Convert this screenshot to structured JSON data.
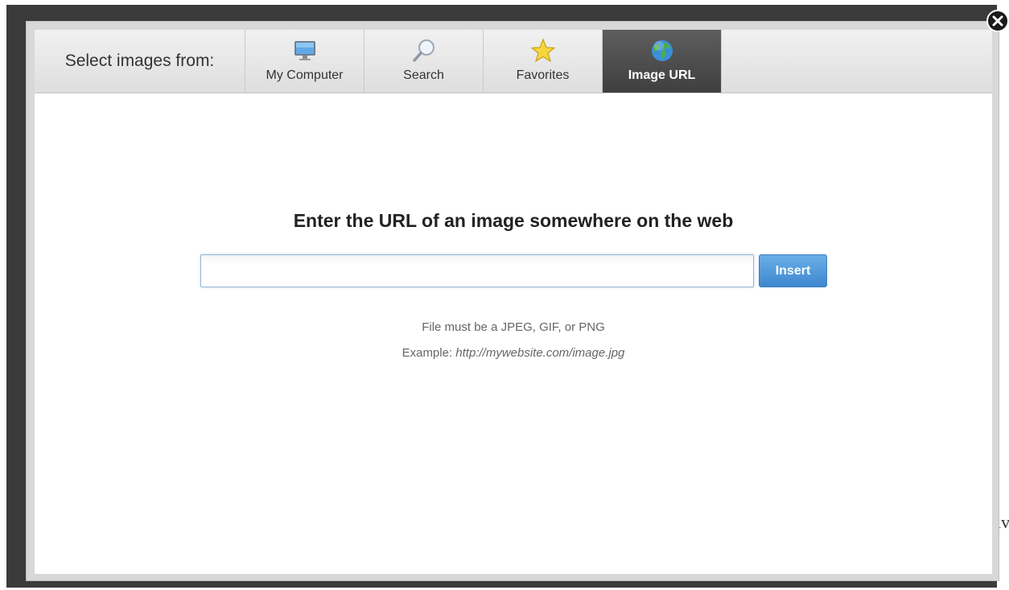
{
  "tabbar": {
    "label": "Select images from:",
    "tabs": [
      {
        "label": "My Computer",
        "icon": "monitor-icon",
        "active": false
      },
      {
        "label": "Search",
        "icon": "magnifier-icon",
        "active": false
      },
      {
        "label": "Favorites",
        "icon": "star-icon",
        "active": false
      },
      {
        "label": "Image URL",
        "icon": "globe-icon",
        "active": true
      }
    ]
  },
  "main": {
    "heading": "Enter the URL of an image somewhere on the web",
    "url_input": {
      "value": "",
      "placeholder": ""
    },
    "insert_label": "Insert",
    "hint_formats": "File must be a JPEG, GIF, or PNG",
    "hint_example_prefix": "Example:",
    "hint_example_url": "http://mywebsite.com/image.jpg"
  },
  "background": {
    "partial_text": "iv"
  },
  "colors": {
    "active_tab": "#4a4a4a",
    "insert_button": "#4a90d9",
    "overlay": "#3b3b3b"
  }
}
